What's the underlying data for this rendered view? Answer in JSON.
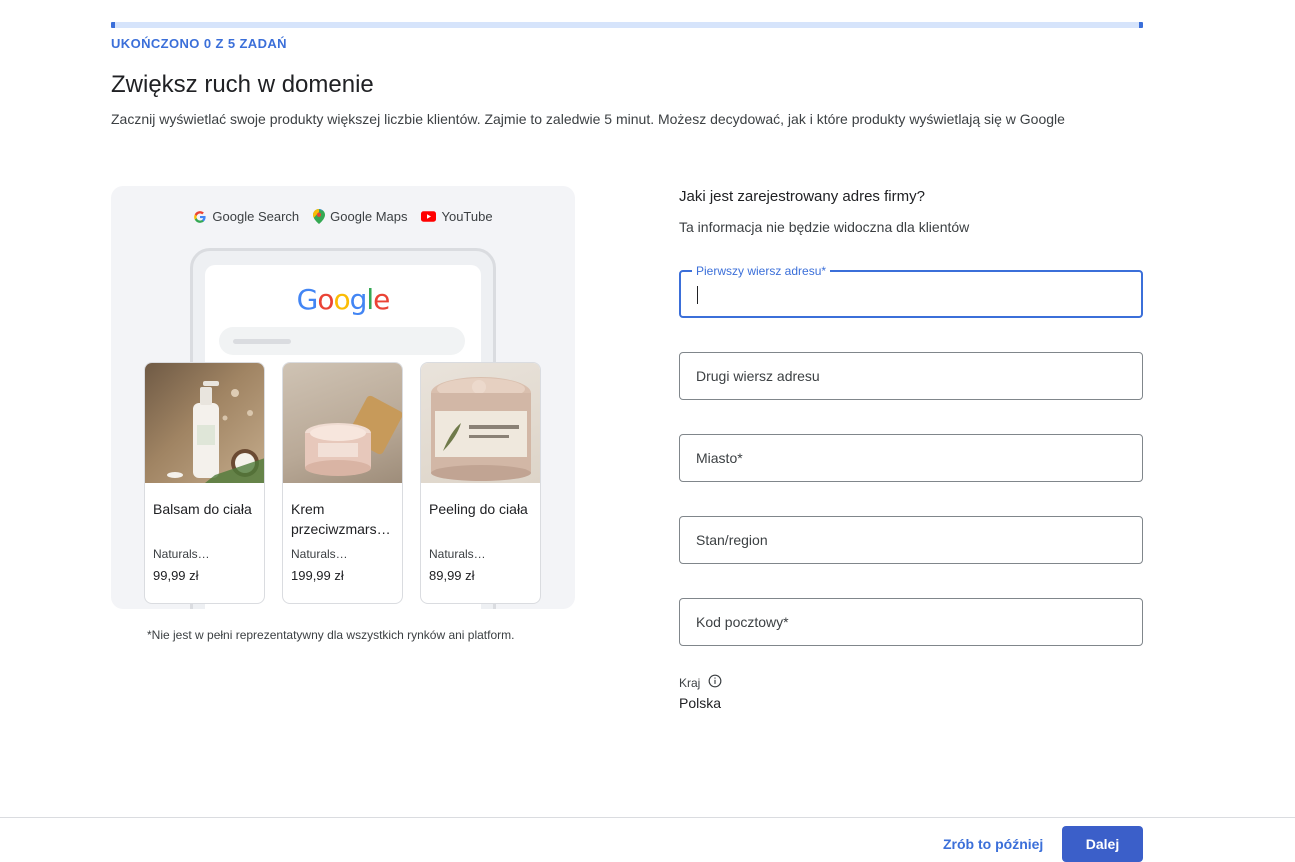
{
  "progress": {
    "text": "UKOŃCZONO 0 Z 5 ZADAŃ",
    "completed": 0,
    "total": 5
  },
  "header": {
    "title": "Zwiększ ruch w domenie",
    "subtitle": "Zacznij wyświetlać swoje produkty większej liczbie klientów. Zajmie to zaledwie 5 minut. Możesz decydować, jak i które produkty wyświetlają się w Google"
  },
  "preview": {
    "platforms": [
      {
        "icon": "google-g-icon",
        "label": "Google Search"
      },
      {
        "icon": "maps-pin-icon",
        "label": "Google Maps"
      },
      {
        "icon": "youtube-icon",
        "label": "YouTube"
      }
    ],
    "logo_text": "Google",
    "products": [
      {
        "name": "Balsam do ciała",
        "name_line2": "",
        "store": "Naturals…",
        "price": "99,99 zł"
      },
      {
        "name": "Krem",
        "name_line2": "przeciwzmarszczkowy",
        "store": "Naturals…",
        "price": "199,99 zł"
      },
      {
        "name": "Peeling do ciała",
        "name_line2": "",
        "store": "Naturals…",
        "price": "89,99 zł"
      }
    ],
    "disclaimer": "*Nie jest w pełni reprezentatywny dla wszystkich rynków ani platform."
  },
  "form": {
    "title": "Jaki jest zarejestrowany adres firmy?",
    "note": "Ta informacja nie będzie widoczna dla klientów",
    "address1": {
      "label": "Pierwszy wiersz adresu*",
      "value": ""
    },
    "address2": {
      "placeholder": "Drugi wiersz adresu",
      "value": ""
    },
    "city": {
      "placeholder": "Miasto*",
      "value": ""
    },
    "region": {
      "placeholder": "Stan/region",
      "value": ""
    },
    "postal": {
      "placeholder": "Kod pocztowy*",
      "value": ""
    },
    "country": {
      "label": "Kraj",
      "value": "Polska"
    }
  },
  "footer": {
    "later_label": "Zrób to później",
    "next_label": "Dalej"
  },
  "colors": {
    "accent": "#3b6fd9",
    "button": "#3b5fc9"
  }
}
